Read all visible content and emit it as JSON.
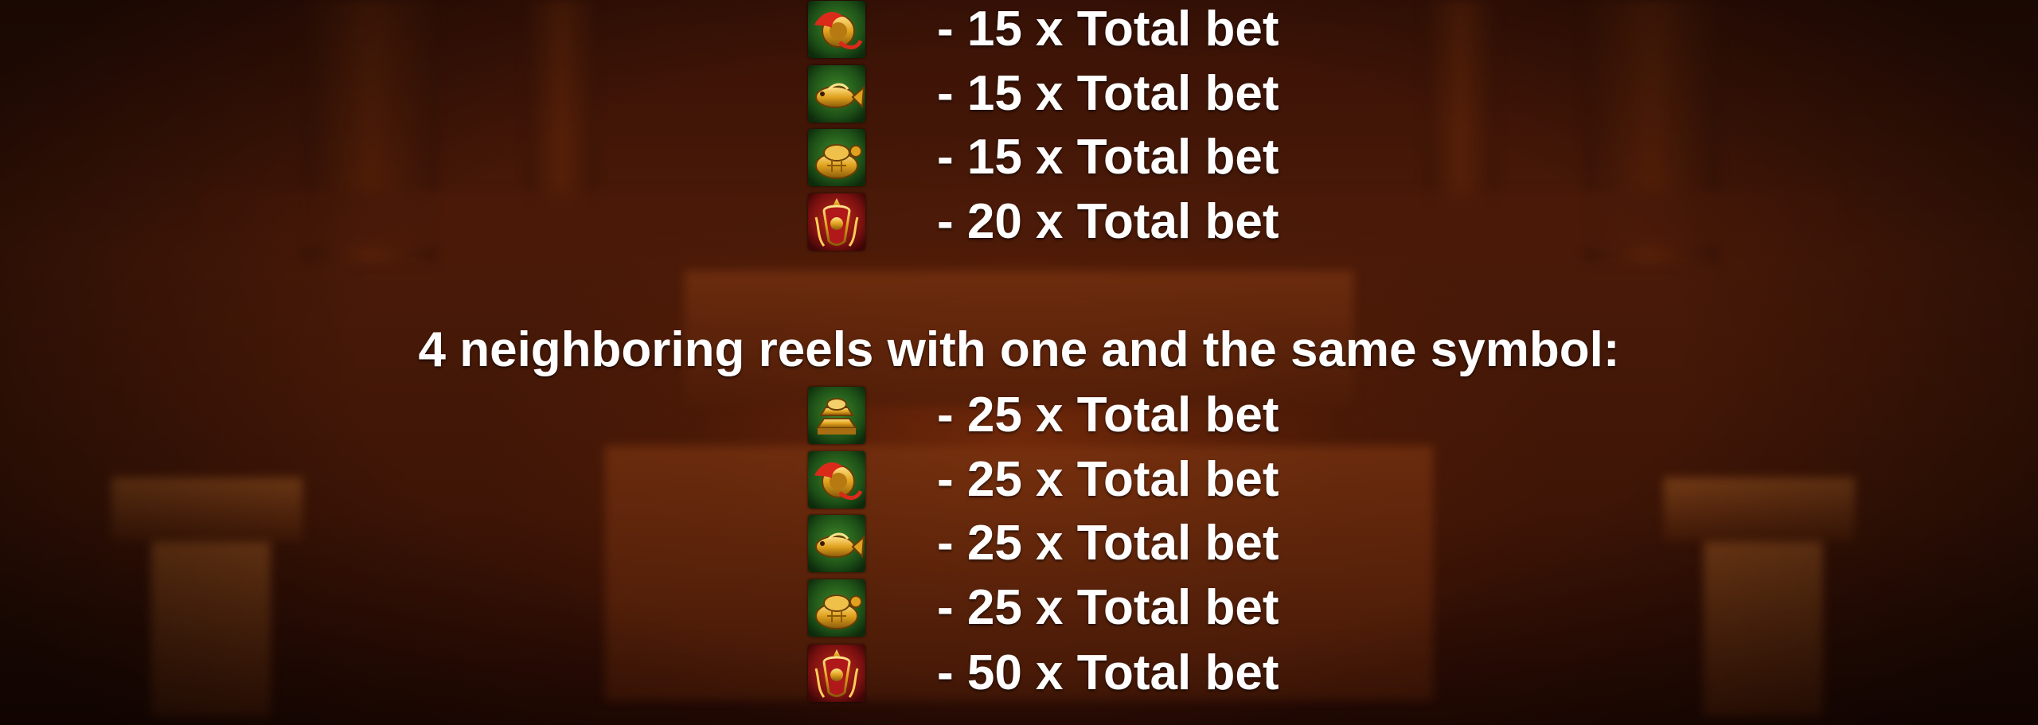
{
  "background": {
    "scene": "temple-hall-blurred",
    "tint": "#4a1a08"
  },
  "upper_section": {
    "rows": [
      {
        "symbol": "dragon-coin-icon",
        "text": "- 15 x Total bet"
      },
      {
        "symbol": "golden-carp-icon",
        "text": "- 15 x Total bet"
      },
      {
        "symbol": "golden-turtle-icon",
        "text": "- 15 x Total bet"
      },
      {
        "symbol": "lucky-charm-icon",
        "text": "- 20 x Total bet"
      }
    ]
  },
  "lower_section": {
    "heading": "4 neighboring reels with one and the same symbol:",
    "rows": [
      {
        "symbol": "gold-ingots-icon",
        "text": "- 25 x Total bet"
      },
      {
        "symbol": "dragon-coin-icon",
        "text": "- 25 x Total bet"
      },
      {
        "symbol": "golden-carp-icon",
        "text": "- 25 x Total bet"
      },
      {
        "symbol": "golden-turtle-icon",
        "text": "- 25 x Total bet"
      },
      {
        "symbol": "lucky-charm-icon",
        "text": "- 50 x Total bet"
      }
    ]
  },
  "colors": {
    "text": "#ffffff",
    "symbol_green": "#1f5a1a",
    "symbol_red": "#8a1010",
    "gold": "#e0a21e"
  }
}
